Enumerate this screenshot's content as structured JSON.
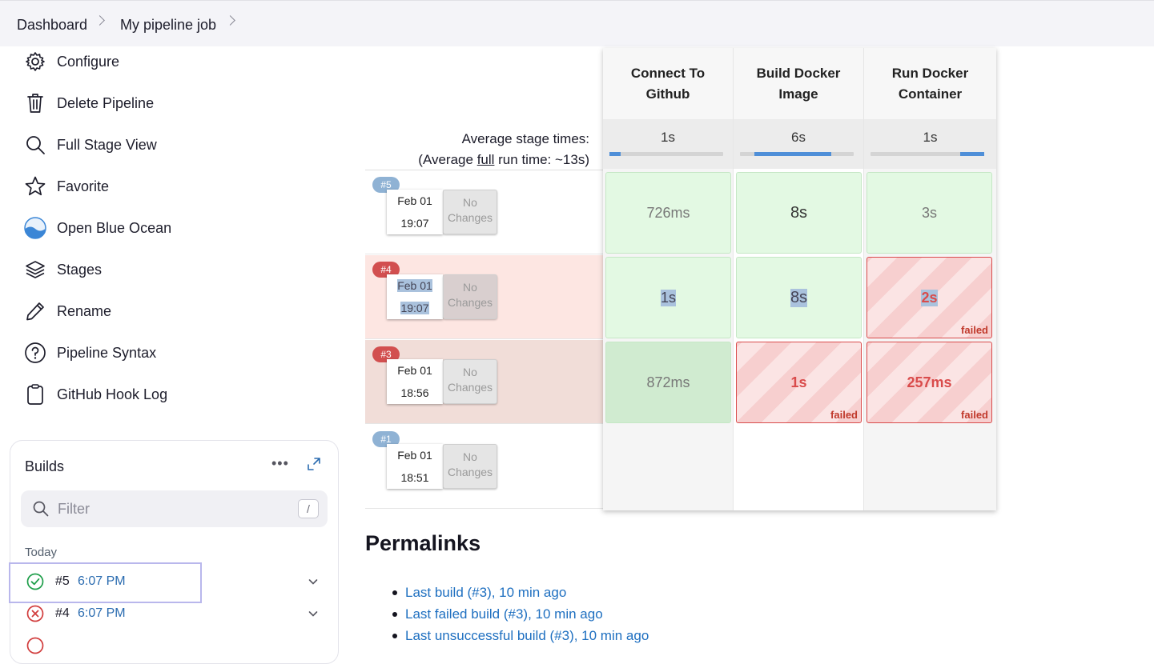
{
  "breadcrumb": {
    "items": [
      "Dashboard",
      "My pipeline job"
    ]
  },
  "sidebar": {
    "items": [
      {
        "label": "Configure",
        "icon": "gear-icon"
      },
      {
        "label": "Delete Pipeline",
        "icon": "trash-icon"
      },
      {
        "label": "Full Stage View",
        "icon": "search-icon"
      },
      {
        "label": "Favorite",
        "icon": "star-icon"
      },
      {
        "label": "Open Blue Ocean",
        "icon": "blue-ocean-icon"
      },
      {
        "label": "Stages",
        "icon": "layers-icon"
      },
      {
        "label": "Rename",
        "icon": "pencil-icon"
      },
      {
        "label": "Pipeline Syntax",
        "icon": "help-circle-icon"
      },
      {
        "label": "GitHub Hook Log",
        "icon": "clipboard-icon"
      }
    ]
  },
  "builds": {
    "title": "Builds",
    "filter_placeholder": "Filter",
    "filter_shortcut": "/",
    "group_label": "Today",
    "items": [
      {
        "number": "#5",
        "time": "6:07 PM",
        "status": "success"
      },
      {
        "number": "#4",
        "time": "6:07 PM",
        "status": "failed"
      }
    ]
  },
  "stage_view": {
    "avg_label_line1": "Average stage times:",
    "avg_label_line2_prefix": "(Average ",
    "avg_label_line2_underlined": "full",
    "avg_label_line2_suffix": " run time: ~13s)",
    "stages": [
      {
        "name": "Connect To Github",
        "avg": "1s",
        "bar_fraction": 0.1
      },
      {
        "name": "Build Docker Image",
        "avg": "6s",
        "bar_fraction": 0.68
      },
      {
        "name": "Run Docker Container",
        "avg": "1s",
        "bar_fraction": 0.2
      }
    ],
    "runs": [
      {
        "badge": "#5",
        "date": "Feb 01",
        "time": "19:07",
        "changes": "No Changes",
        "cells": [
          "726ms",
          "8s",
          "3s"
        ],
        "failed_labels": [
          "",
          "",
          ""
        ]
      },
      {
        "badge": "#4",
        "date": "Feb 01",
        "time": "19:07",
        "changes": "No Changes",
        "cells": [
          "1s",
          "8s",
          "2s"
        ],
        "failed_labels": [
          "",
          "",
          "failed"
        ]
      },
      {
        "badge": "#3",
        "date": "Feb 01",
        "time": "18:56",
        "changes": "No Changes",
        "cells": [
          "872ms",
          "1s",
          "257ms"
        ],
        "failed_labels": [
          "",
          "failed",
          "failed"
        ]
      },
      {
        "badge": "#1",
        "date": "Feb 01",
        "time": "18:51",
        "changes": "No Changes",
        "cells": [
          "",
          "",
          ""
        ],
        "failed_labels": [
          "",
          "",
          ""
        ]
      }
    ]
  },
  "permalinks": {
    "title": "Permalinks",
    "links": [
      "Last build (#3), 10 min ago",
      "Last failed build (#3), 10 min ago",
      "Last unsuccessful build (#3), 10 min ago"
    ]
  },
  "colors": {
    "success_badge": "#8fb2d4",
    "failed_badge": "#d24f4f",
    "link": "#1e6fc0"
  }
}
